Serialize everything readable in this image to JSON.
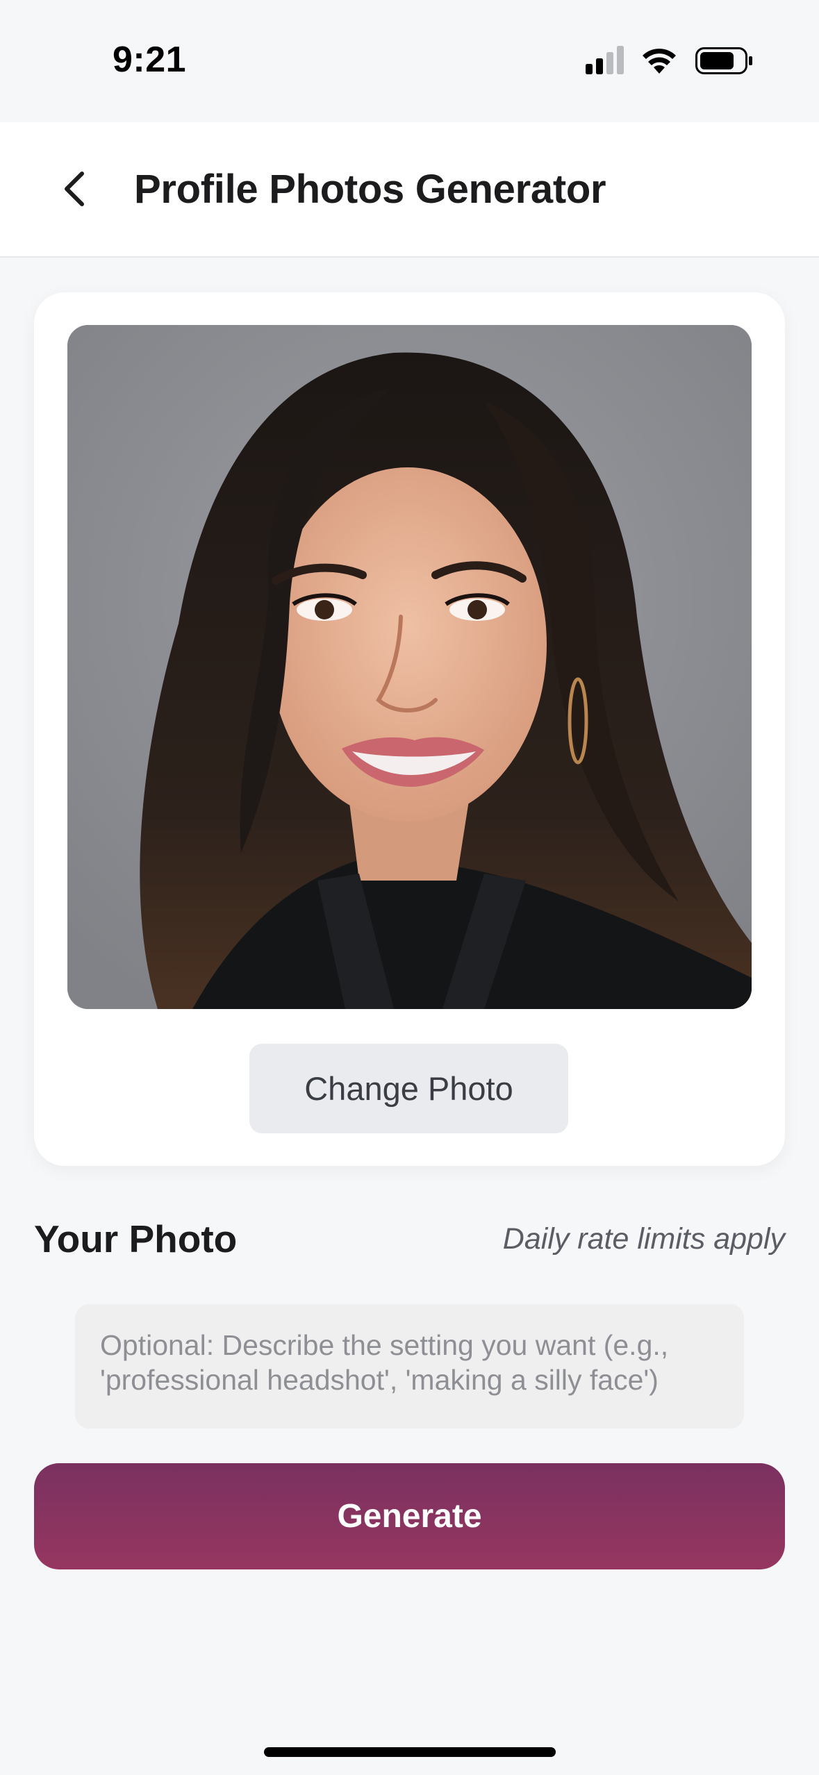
{
  "status_bar": {
    "time": "9:21"
  },
  "nav": {
    "title": "Profile Photos Generator",
    "back_icon": "chevron-left-icon"
  },
  "photo_card": {
    "photo_alt": "Uploaded portrait photo",
    "change_photo_label": "Change Photo"
  },
  "section": {
    "title": "Your Photo",
    "rate_note": "Daily rate limits apply"
  },
  "prompt": {
    "value": "",
    "placeholder": "Optional: Describe the setting you want (e.g., 'professional headshot', 'making a silly face')"
  },
  "actions": {
    "generate_label": "Generate"
  },
  "colors": {
    "background": "#f6f7f9",
    "accent_top": "#7a3160",
    "accent_bottom": "#963660",
    "button_secondary": "#e9ebee"
  }
}
